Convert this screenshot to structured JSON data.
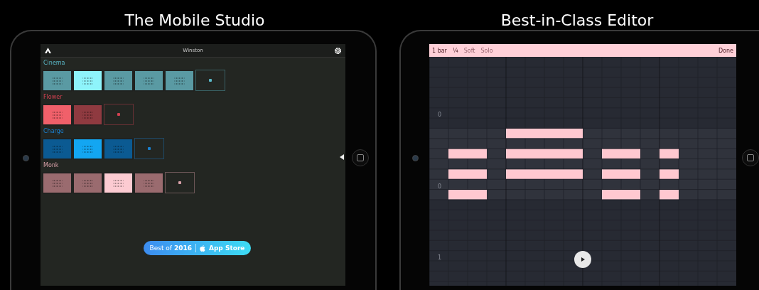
{
  "mobile_studio": {
    "title": "The Mobile Studio",
    "screen": {
      "title": "Winston",
      "groups": [
        {
          "name": "Cinema",
          "color": "#5ab8c8",
          "tiles": [
            {
              "color": "#5a9aa3"
            },
            {
              "color": "#8ef4fb"
            },
            {
              "color": "#5a9aa3"
            },
            {
              "color": "#5a9aa3"
            },
            {
              "color": "#5a9aa3"
            }
          ]
        },
        {
          "name": "Flower",
          "color": "#d04050",
          "tiles": [
            {
              "color": "#f0606a"
            },
            {
              "color": "#8f3a40"
            }
          ]
        },
        {
          "name": "Charge",
          "color": "#1a80d0",
          "tiles": [
            {
              "color": "#0b5a92"
            },
            {
              "color": "#13a6f2"
            },
            {
              "color": "#0b5a92"
            }
          ]
        },
        {
          "name": "Monk",
          "color": "#d8a0a8",
          "tiles": [
            {
              "color": "#9a6b6f"
            },
            {
              "color": "#9a6b6f"
            },
            {
              "color": "#fccbd2"
            },
            {
              "color": "#9a6b6f"
            }
          ]
        }
      ],
      "badge": {
        "text": "Best of **2016**",
        "store": "App Store"
      }
    }
  },
  "editor": {
    "title": "Best-in-Class Editor",
    "toolbar": {
      "items": [
        {
          "label": "1 bar",
          "disabled": false
        },
        {
          "label": "¼",
          "disabled": false
        },
        {
          "label": "Soft",
          "disabled": true
        },
        {
          "label": "Solo",
          "disabled": true
        }
      ],
      "done": "Done"
    },
    "row_labels": [
      "0",
      "0",
      "1"
    ]
  }
}
